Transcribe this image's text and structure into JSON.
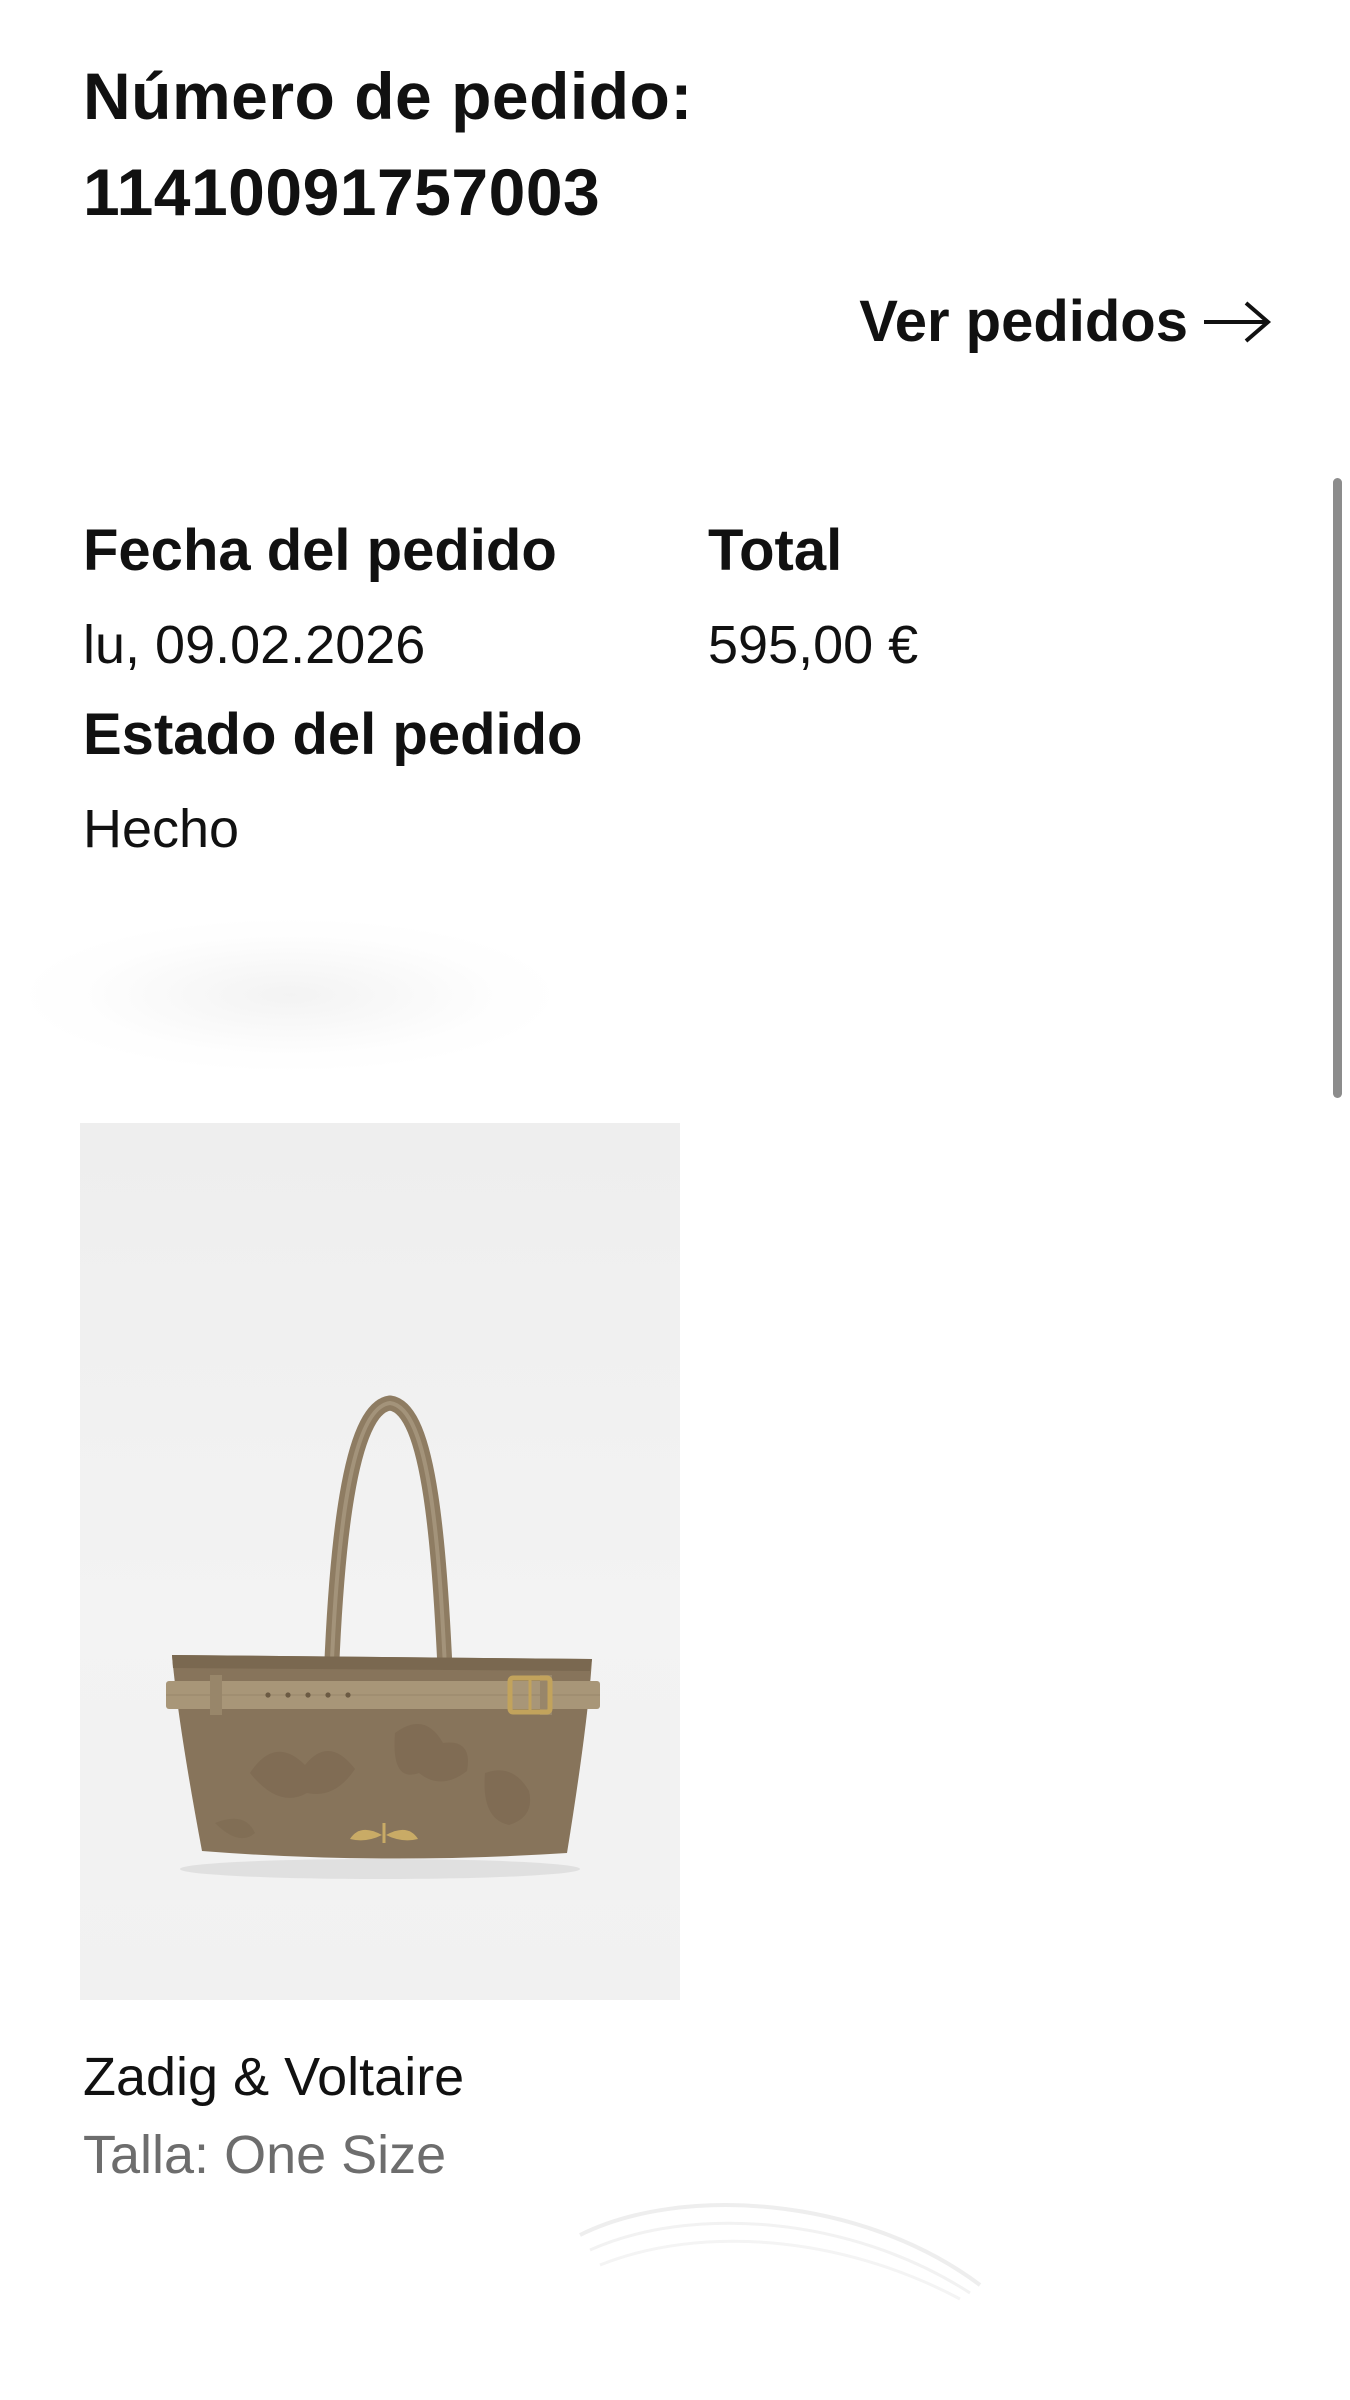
{
  "order": {
    "number_label": "Número de pedido:",
    "number_value": "11410091757003",
    "view_orders_label": "Ver pedidos",
    "view_orders_icon": "arrow-right-icon"
  },
  "details": {
    "date_label": "Fecha del pedido",
    "date_value": "lu, 09.02.2026",
    "total_label": "Total",
    "total_value": "595,00 €",
    "status_label": "Estado del pedido",
    "status_value": "Hecho"
  },
  "product": {
    "image_subject": "tote-bag",
    "bag_color": "#87745b",
    "brand": "Zadig & Voltaire",
    "size_text": "Talla: One Size"
  },
  "colors": {
    "text": "#111111",
    "muted_text": "#6d6d6d",
    "image_background": "#efefef",
    "scrollbar": "#8c8c8c"
  }
}
